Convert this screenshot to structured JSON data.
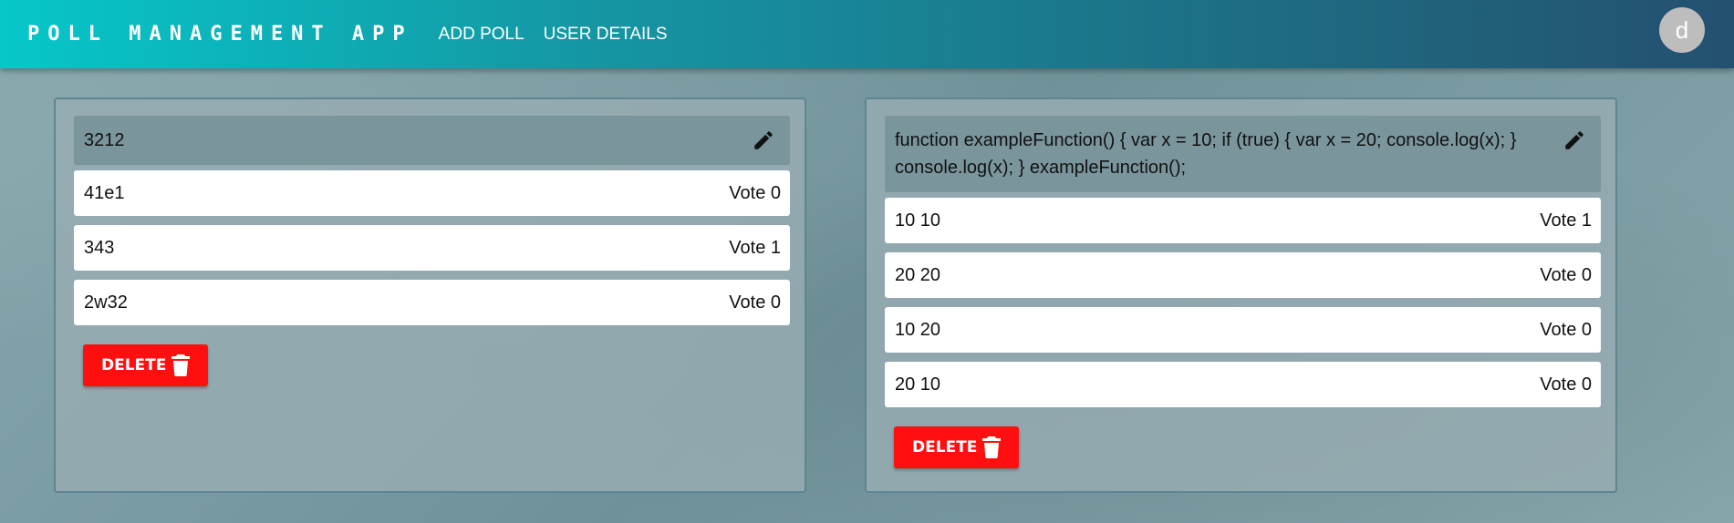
{
  "navbar": {
    "brand": "POLL MANAGEMENT APP",
    "links": [
      "ADD POLL",
      "USER DETAILS"
    ],
    "avatar_letter": "d"
  },
  "polls": [
    {
      "question": "3212",
      "options": [
        {
          "text": "41e1",
          "vote": "Vote 0"
        },
        {
          "text": "343",
          "vote": "Vote 1"
        },
        {
          "text": "2w32",
          "vote": "Vote 0"
        }
      ],
      "delete_label": "DELETE"
    },
    {
      "question": "function exampleFunction() { var x = 10; if (true) { var x = 20; console.log(x); } console.log(x); } exampleFunction();",
      "options": [
        {
          "text": "10 10",
          "vote": "Vote 1"
        },
        {
          "text": "20 20",
          "vote": "Vote 0"
        },
        {
          "text": "10 20",
          "vote": "Vote 0"
        },
        {
          "text": "20 10",
          "vote": "Vote 0"
        }
      ],
      "delete_label": "DELETE"
    }
  ],
  "colors": {
    "navbar_start": "#06c7c9",
    "navbar_end": "#245070",
    "delete": "#ff0f0f",
    "question_bg": "#7a959c"
  },
  "icons": {
    "edit": "pencil-icon",
    "delete": "trash-icon"
  }
}
